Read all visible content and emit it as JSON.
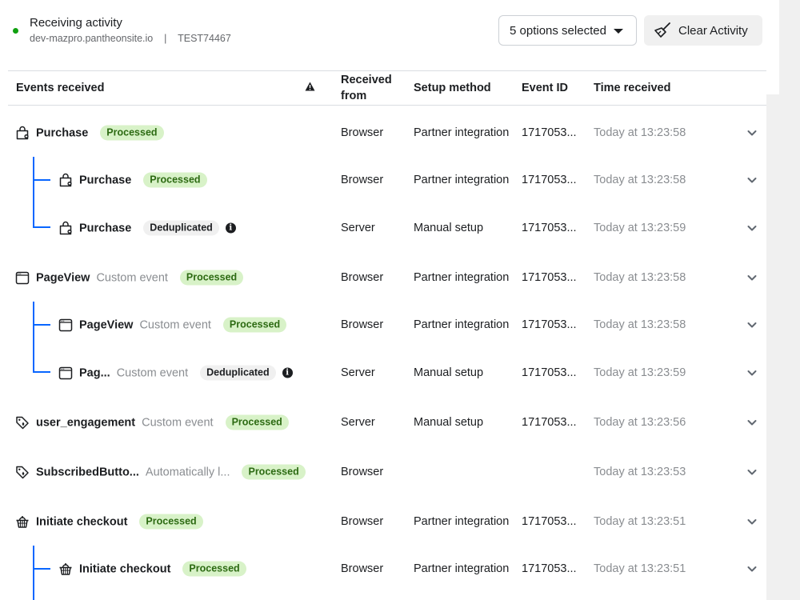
{
  "header": {
    "status_title": "Receiving activity",
    "status_color": "#0fa00f",
    "site": "dev-mazpro.pantheonsite.io",
    "separator": "|",
    "test_code": "TEST74467",
    "filter_select": "5 options selected",
    "clear_button": "Clear Activity"
  },
  "table": {
    "columns": {
      "events": "Events received",
      "from": "Received from",
      "setup": "Setup method",
      "event_id": "Event ID",
      "time": "Time received"
    },
    "warning_icon": "warning-triangle-icon",
    "rows": [
      {
        "icon": "shopping-bag-icon",
        "name": "Purchase",
        "type": "",
        "status": "Processed",
        "from": "Browser",
        "setup": "Partner integration",
        "event_id": "1717053...",
        "time": "Today at 13:23:58",
        "child": false
      },
      {
        "icon": "shopping-bag-icon",
        "name": "Purchase",
        "type": "",
        "status": "Processed",
        "from": "Browser",
        "setup": "Partner integration",
        "event_id": "1717053...",
        "time": "Today at 13:23:58",
        "child": true
      },
      {
        "icon": "shopping-bag-icon",
        "name": "Purchase",
        "type": "",
        "status": "Deduplicated",
        "info": true,
        "from": "Server",
        "setup": "Manual setup",
        "event_id": "1717053...",
        "time": "Today at 13:23:59",
        "child": true
      },
      {
        "icon": "browser-window-icon",
        "name": "PageView",
        "type": "Custom event",
        "status": "Processed",
        "from": "Browser",
        "setup": "Partner integration",
        "event_id": "1717053...",
        "time": "Today at 13:23:58",
        "child": false
      },
      {
        "icon": "browser-window-icon",
        "name": "PageView",
        "type": "Custom event",
        "status": "Processed",
        "from": "Browser",
        "setup": "Partner integration",
        "event_id": "1717053...",
        "time": "Today at 13:23:58",
        "child": true
      },
      {
        "icon": "browser-window-icon",
        "name": "Pag...",
        "type": "Custom event",
        "status": "Deduplicated",
        "info": true,
        "from": "Server",
        "setup": "Manual setup",
        "event_id": "1717053...",
        "time": "Today at 13:23:59",
        "child": true
      },
      {
        "icon": "tag-icon",
        "name": "user_engagement",
        "type": "Custom event",
        "status": "Processed",
        "from": "Server",
        "setup": "Manual setup",
        "event_id": "1717053...",
        "time": "Today at 13:23:56",
        "child": false
      },
      {
        "icon": "tag-icon",
        "name": "SubscribedButto...",
        "type": "Automatically l...",
        "status": "Processed",
        "from": "Browser",
        "setup": "",
        "event_id": "",
        "time": "Today at 13:23:53",
        "child": false
      },
      {
        "icon": "basket-icon",
        "name": "Initiate checkout",
        "type": "",
        "status": "Processed",
        "from": "Browser",
        "setup": "Partner integration",
        "event_id": "1717053...",
        "time": "Today at 13:23:51",
        "child": false
      },
      {
        "icon": "basket-icon",
        "name": "Initiate checkout",
        "type": "",
        "status": "Processed",
        "from": "Browser",
        "setup": "Partner integration",
        "event_id": "1717053...",
        "time": "Today at 13:23:51",
        "child": true
      }
    ]
  }
}
